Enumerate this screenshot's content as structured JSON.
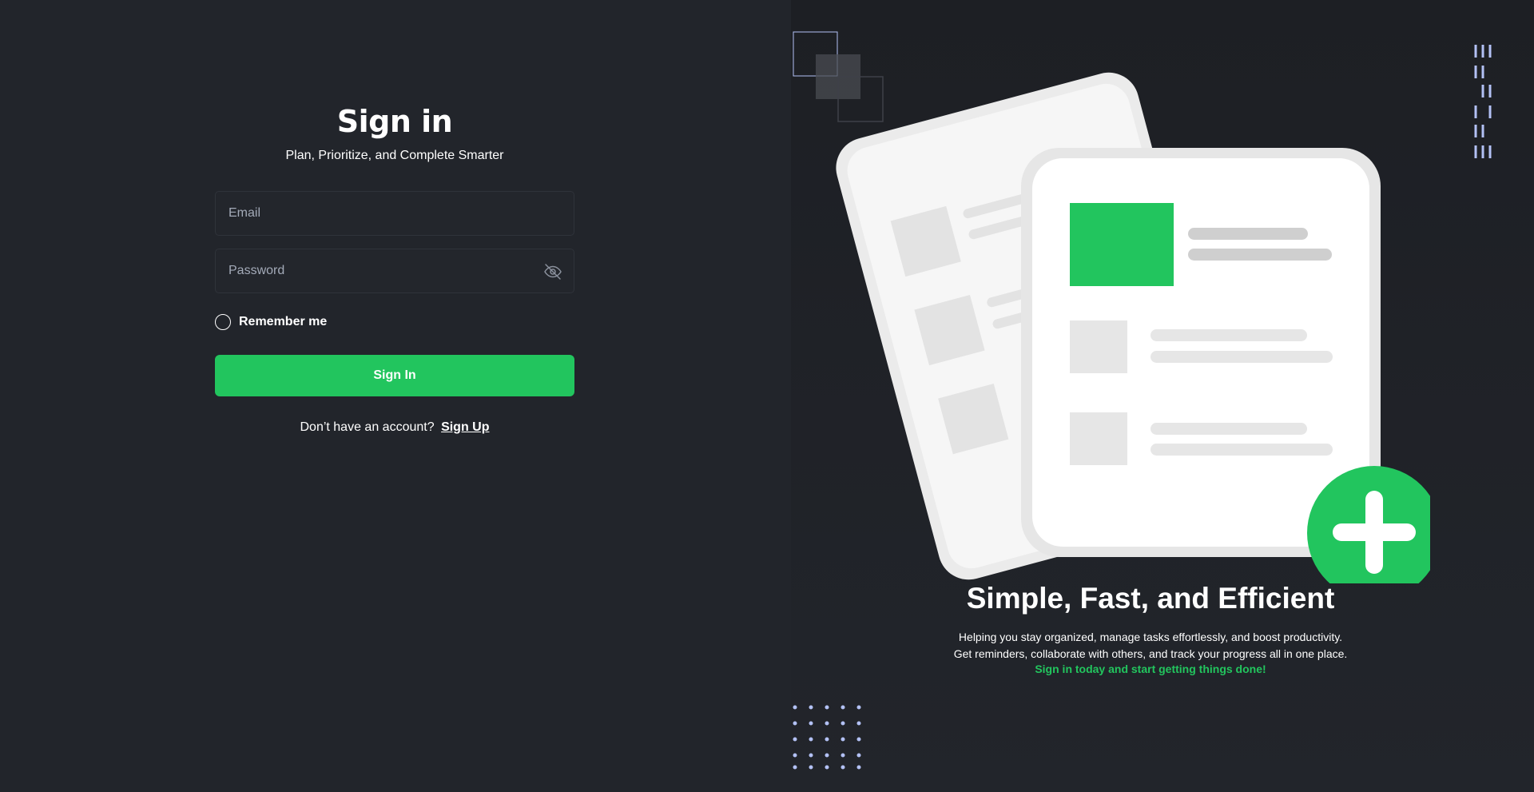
{
  "signin": {
    "title": "Sign in",
    "subtitle": "Plan, Prioritize, and Complete Smarter",
    "email_placeholder": "Email",
    "password_placeholder": "Password",
    "remember_label": "Remember me",
    "button_label": "Sign In",
    "signup_prompt": "Don’t have an account?",
    "signup_link": "Sign Up"
  },
  "hero": {
    "title": "Simple, Fast, and Efficient",
    "line1": "Helping you stay organized, manage tasks effortlessly, and boost productivity.",
    "line2": "Get reminders, collaborate with others, and track your progress all in one place.",
    "cta": "Sign in today and start getting things done!"
  },
  "colors": {
    "accent": "#22c55e",
    "background": "#22252b",
    "decor": "#b3c1f5"
  },
  "icons": {
    "password_toggle": "eye-slash-icon",
    "add": "plus-icon"
  }
}
